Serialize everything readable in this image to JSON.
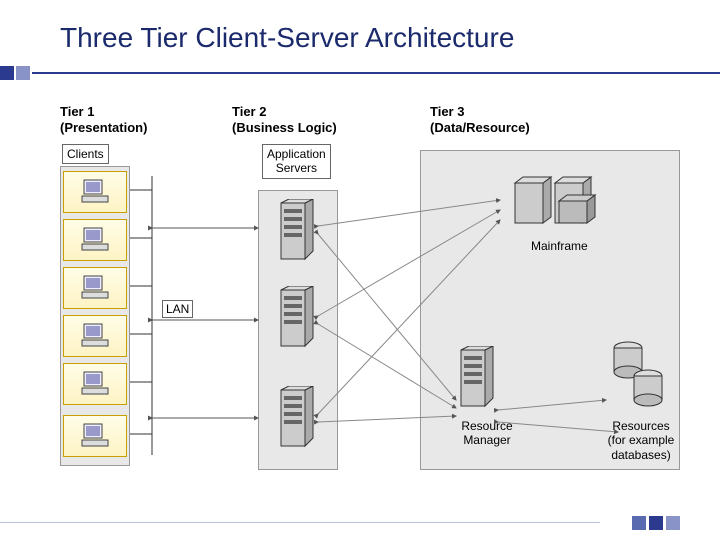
{
  "title": "Three Tier Client-Server Architecture",
  "tier1": {
    "header_line1": "Tier 1",
    "header_line2": "(Presentation)",
    "clients_label": "Clients"
  },
  "tier2": {
    "header_line1": "Tier 2",
    "header_line2": "(Business Logic)",
    "servers_label_line1": "Application",
    "servers_label_line2": "Servers"
  },
  "tier3": {
    "header_line1": "Tier 3",
    "header_line2": "(Data/Resource)",
    "mainframe_label": "Mainframe",
    "resmgr_label_line1": "Resource",
    "resmgr_label_line2": "Manager",
    "resources_label_line1": "Resources",
    "resources_label_line2": "(for example",
    "resources_label_line3": "databases)"
  },
  "lan_label": "LAN",
  "colors": {
    "accent": "#2b3a8f",
    "client_border": "#c8a000"
  }
}
